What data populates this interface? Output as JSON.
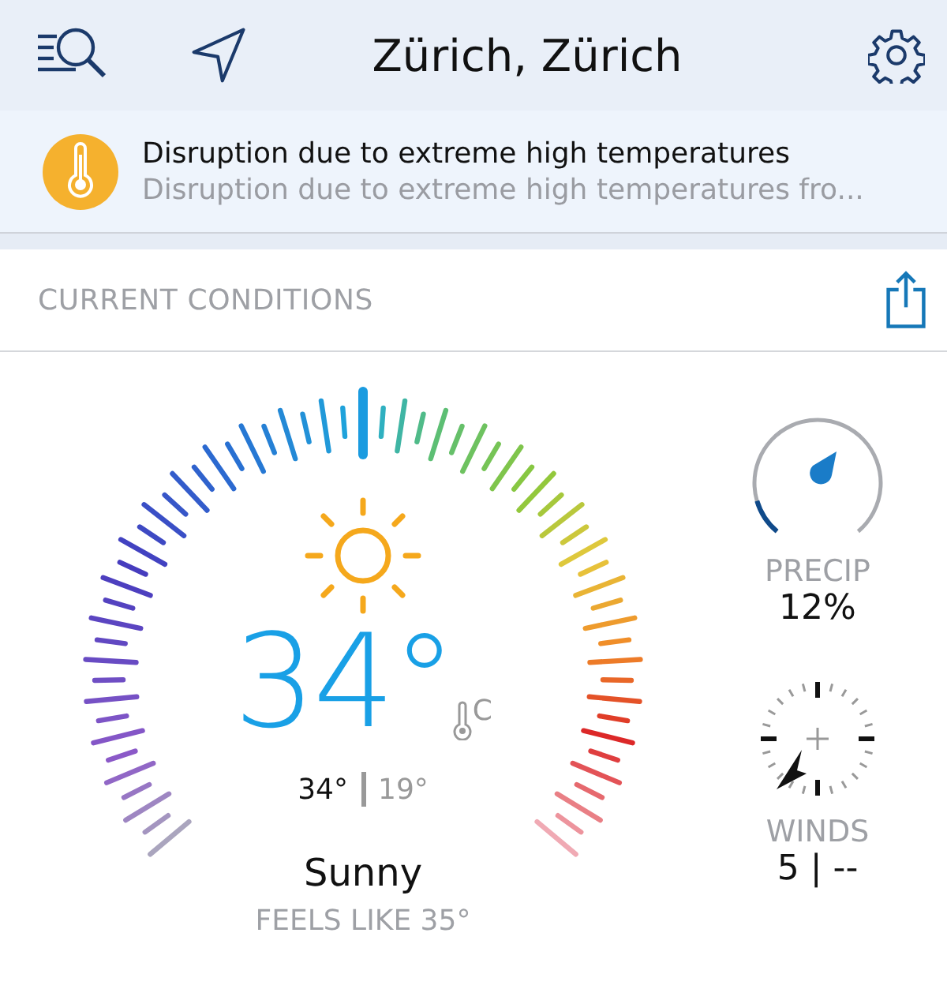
{
  "header": {
    "title": "Zürich, Zürich"
  },
  "alert": {
    "title": "Disruption due to extreme high temperatures",
    "summary": "Disruption due to extreme high temperatures fro..."
  },
  "section": {
    "title": "CURRENT CONDITIONS"
  },
  "current": {
    "temperature": "34°",
    "unit": "C",
    "high": "34°",
    "low": "19°",
    "condition": "Sunny",
    "feels_like": "FEELS LIKE 35°"
  },
  "precip": {
    "label": "PRECIP",
    "value": "12%"
  },
  "winds": {
    "label": "WINDS",
    "value": "5 | --"
  }
}
